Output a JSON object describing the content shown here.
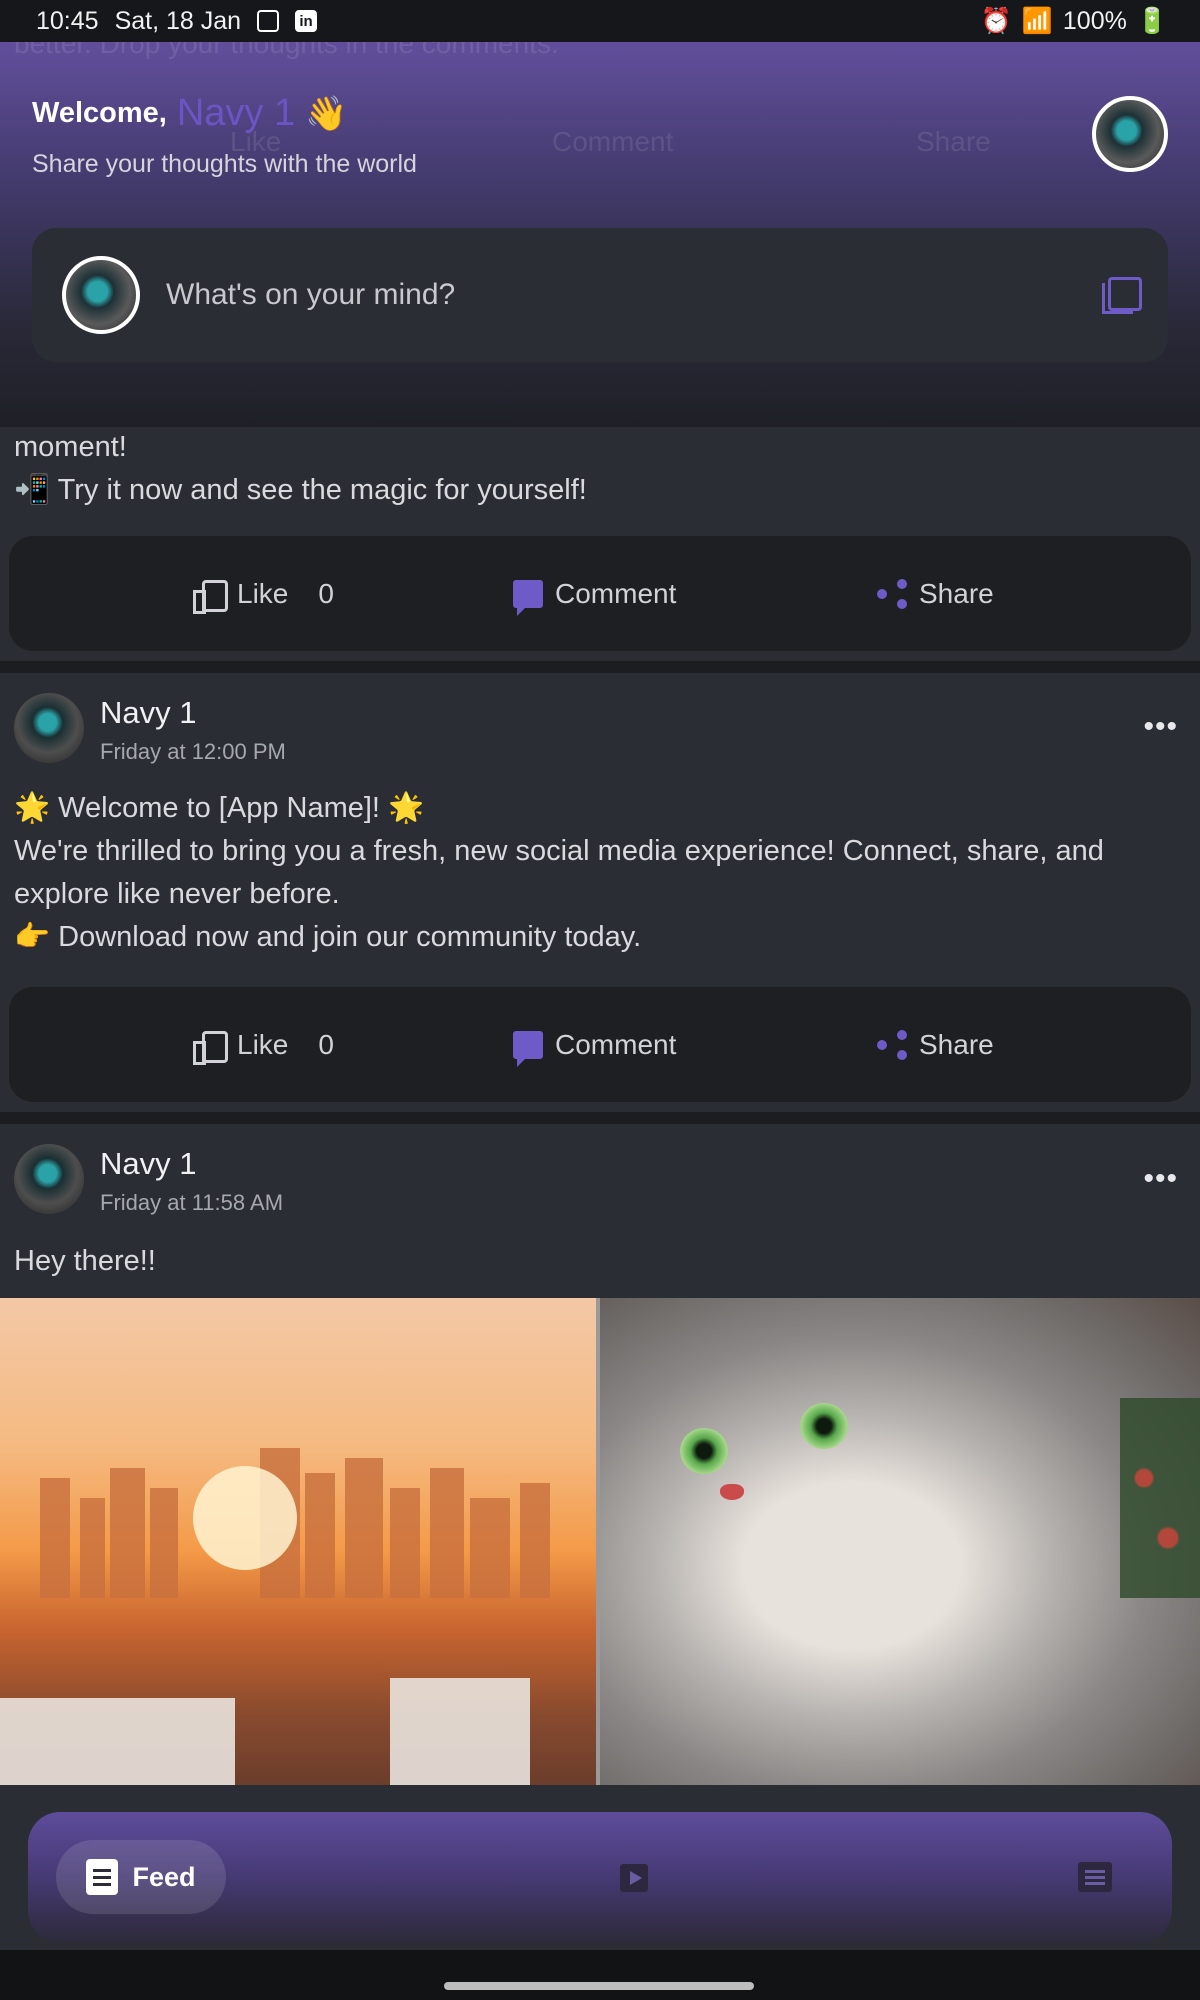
{
  "statusbar": {
    "time": "10:45",
    "date": "Sat, 18 Jan",
    "battery": "100%"
  },
  "header": {
    "welcome": "Welcome,",
    "user_name": "Navy 1",
    "wave_icon": "👋",
    "tagline": "Share your thoughts with the world",
    "composer_placeholder": "What's on your mind?",
    "ghost_like": "Like",
    "ghost_comment": "Comment",
    "ghost_share": "Share",
    "ghost_text": "better. Drop your thoughts in the comments."
  },
  "posts": [
    {
      "lines": [
        "moment!",
        "📲 Try it now and see the magic for yourself!"
      ],
      "actions": {
        "like": "Like",
        "likes_count": "0",
        "comment": "Comment",
        "share": "Share"
      }
    },
    {
      "author": "Navy 1",
      "time": "Friday at 12:00 PM",
      "lines": [
        "🌟 Welcome to [App Name]! 🌟",
        "We're thrilled to bring you a fresh, new social media experience! Connect, share, and",
        "explore like never before.",
        "👉 Download now and join our community today."
      ],
      "actions": {
        "like": "Like",
        "likes_count": "0",
        "comment": "Comment",
        "share": "Share"
      }
    },
    {
      "author": "Navy 1",
      "time": "Friday at 11:58 AM",
      "lines": [
        "Hey there!!"
      ]
    }
  ],
  "bottom_nav": {
    "feed": "Feed"
  },
  "more_glyph": "•••"
}
